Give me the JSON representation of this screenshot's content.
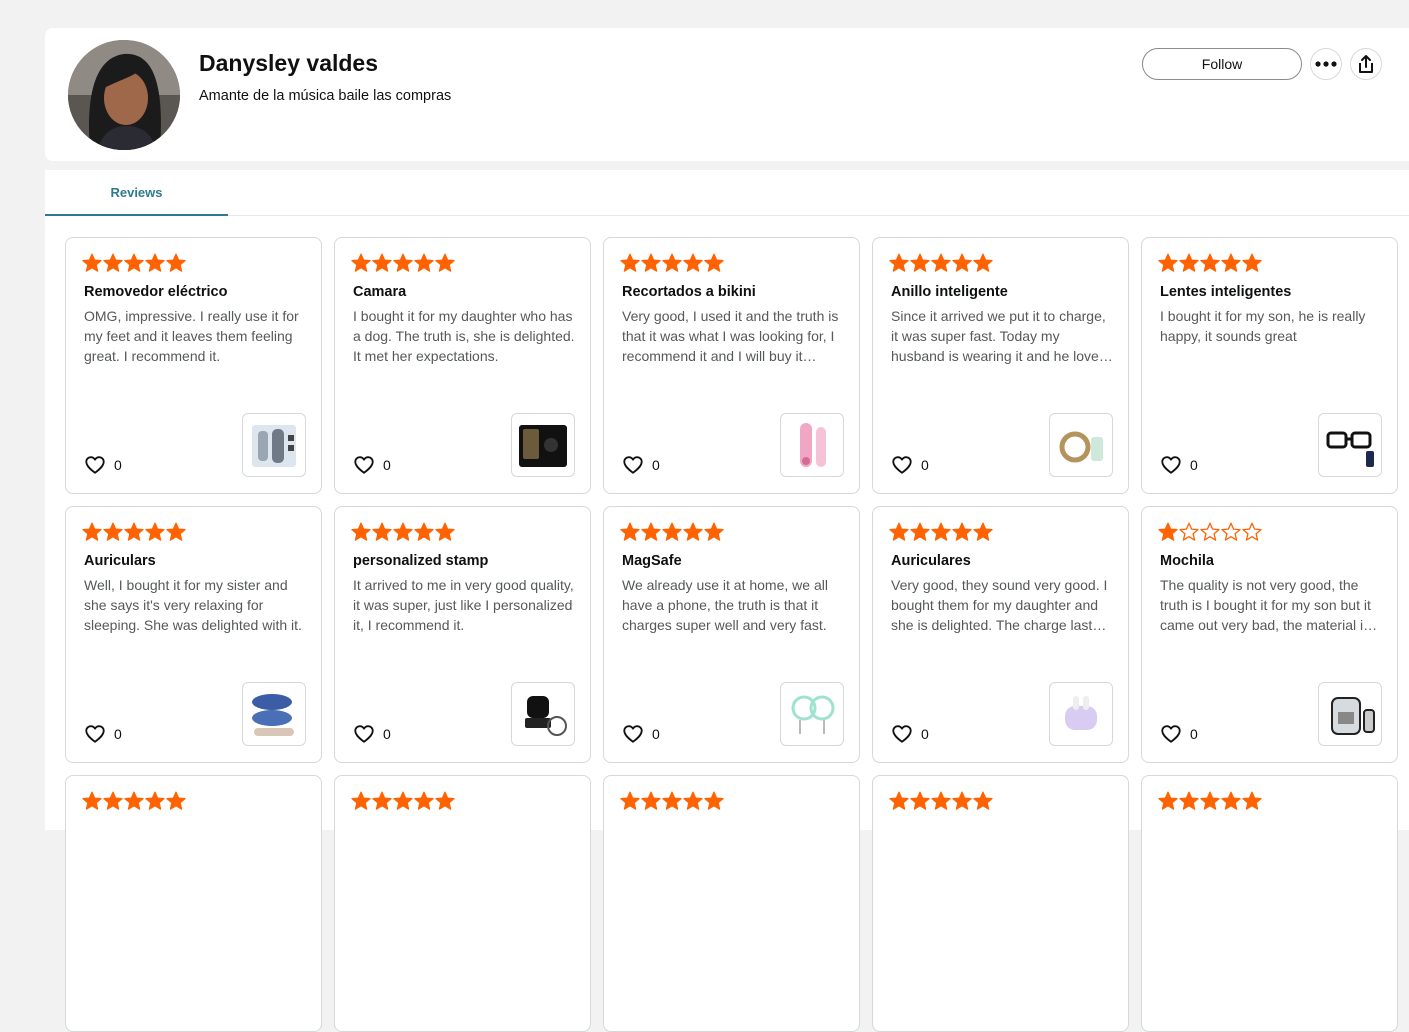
{
  "profile": {
    "name": "Danysley valdes",
    "bio": "Amante de la música baile las compras",
    "follow_label": "Follow"
  },
  "tabs": [
    {
      "label": "Reviews",
      "active": true
    }
  ],
  "colors": {
    "star": "#ff6200",
    "tab_accent": "#2e7b90"
  },
  "reviews": [
    {
      "rating": 5,
      "title": "Removedor eléctrico",
      "text": "OMG, impressive. I really use it for my feet and it leaves them feeling great. I recommend it.",
      "likes": "0",
      "thumb_icon": "foot-file-icon"
    },
    {
      "rating": 5,
      "title": "Camara",
      "text": "I bought it for my daughter who has a dog. The truth is, she is delighted. It met her expectations.",
      "likes": "0",
      "thumb_icon": "camera-icon"
    },
    {
      "rating": 5,
      "title": "Recortados a bikini",
      "text": "Very good, I used it and the truth is that it was what I was looking for, I recommend it and I will buy it again.",
      "likes": "0",
      "thumb_icon": "trimmer-icon"
    },
    {
      "rating": 5,
      "title": "Anillo inteligente",
      "text": "Since it arrived we put it to charge, it was super fast. Today my husband is wearing it and he loves it.",
      "likes": "0",
      "thumb_icon": "smart-ring-icon"
    },
    {
      "rating": 5,
      "title": "Lentes inteligentes",
      "text": "I bought it for my son, he is really happy, it sounds great",
      "likes": "0",
      "thumb_icon": "glasses-icon"
    },
    {
      "rating": 5,
      "title": "Auriculars",
      "text": "Well, I bought it for my sister and she says it's very relaxing for sleeping. She was delighted with it.",
      "likes": "0",
      "thumb_icon": "sleep-mask-icon"
    },
    {
      "rating": 5,
      "title": "personalized stamp",
      "text": "It arrived to me in very good quality, it was super, just like I personalized it, I recommend it.",
      "likes": "0",
      "thumb_icon": "stamp-icon"
    },
    {
      "rating": 5,
      "title": "MagSafe",
      "text": "We already use it at home, we all have a phone, the truth is that it charges super well and very fast.",
      "likes": "0",
      "thumb_icon": "magsafe-icon"
    },
    {
      "rating": 5,
      "title": "Auriculares",
      "text": "Very good, they sound very good. I bought them for my daughter and she is delighted. The charge lasts long.",
      "likes": "0",
      "thumb_icon": "earbuds-icon"
    },
    {
      "rating": 1,
      "title": "Mochila",
      "text": "The quality is not very good, the truth is I bought it for my son but it came out very bad, the material is thin.",
      "likes": "0",
      "thumb_icon": "backpack-icon"
    },
    {
      "rating": 5
    },
    {
      "rating": 5
    },
    {
      "rating": 5
    },
    {
      "rating": 5
    },
    {
      "rating": 5
    }
  ]
}
